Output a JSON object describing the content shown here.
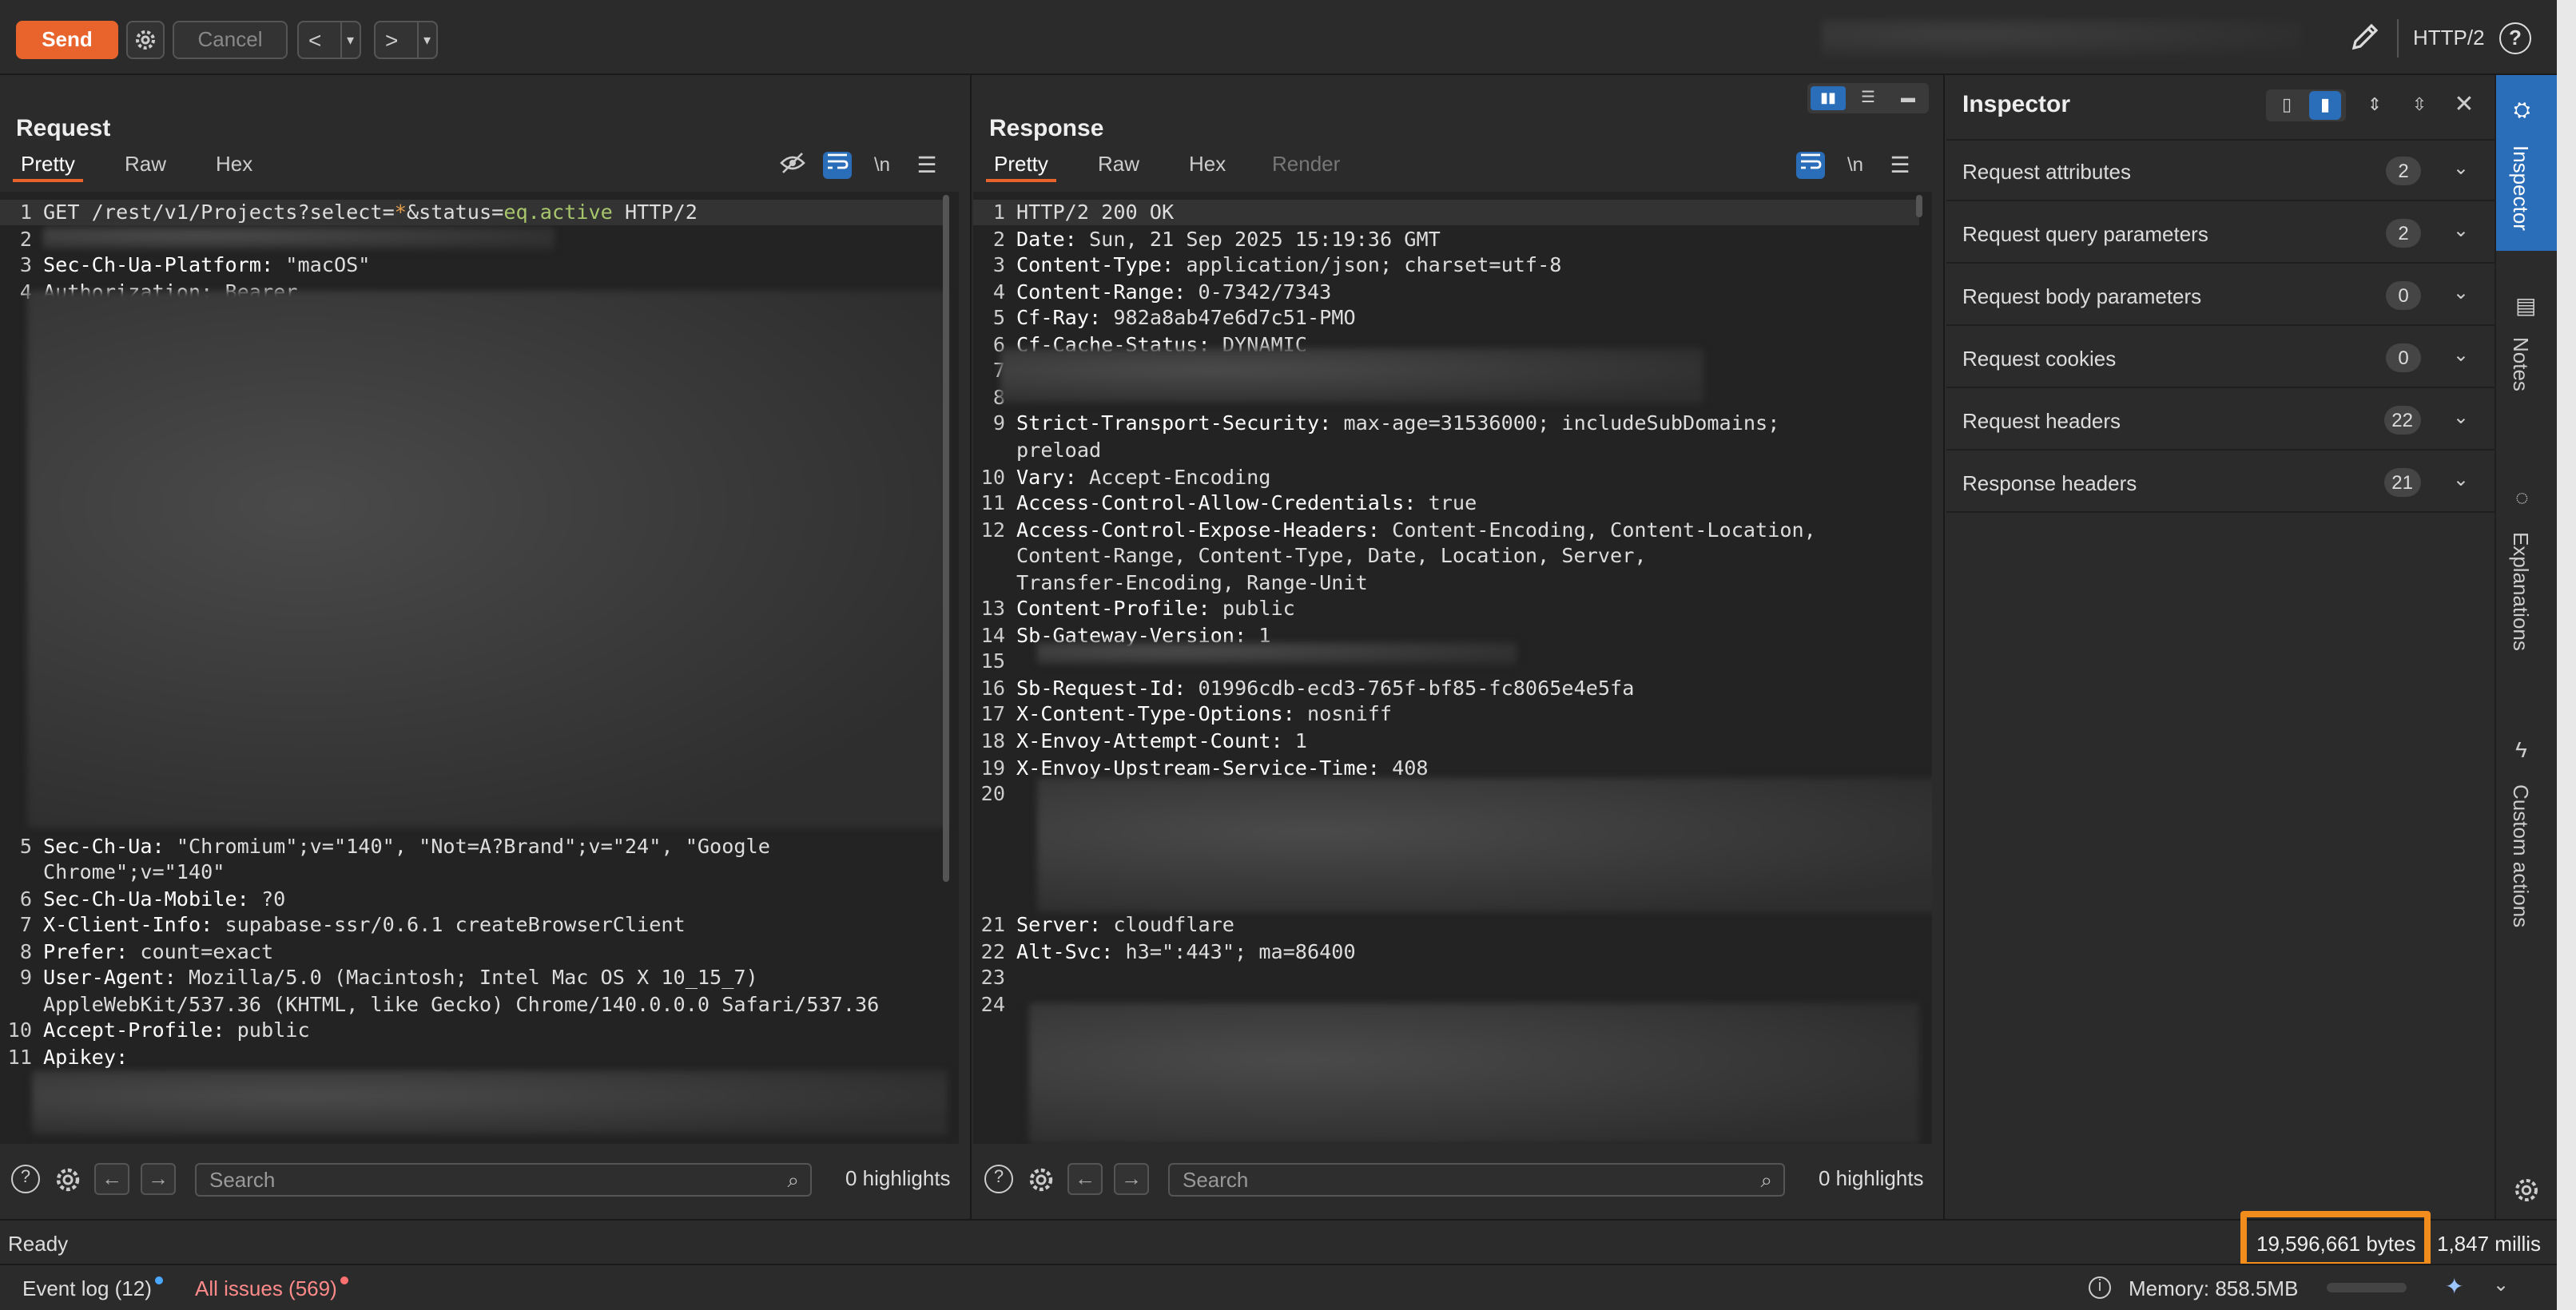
{
  "toolbar": {
    "send": "Send",
    "cancel": "Cancel",
    "back": "<",
    "forward": ">",
    "dropdown": "▾",
    "protocol": "HTTP/2"
  },
  "request": {
    "title": "Request",
    "tabs": [
      "Pretty",
      "Raw",
      "Hex"
    ],
    "active_tab": "Pretty",
    "lines": [
      {
        "n": "1",
        "parts": [
          {
            "t": "GET /rest/v1/Projects?select="
          },
          {
            "t": "*",
            "c": "orange"
          },
          {
            "t": "&status="
          },
          {
            "t": "eq.active",
            "c": "green"
          },
          {
            "t": " HTTP/2"
          }
        ]
      },
      {
        "n": "2",
        "parts": [
          {
            "t": ""
          }
        ]
      },
      {
        "n": "3",
        "parts": [
          {
            "t": "Sec-Ch-Ua-Platform:",
            "c": "k"
          },
          {
            "t": " \"macOS\""
          }
        ]
      },
      {
        "n": "4",
        "parts": [
          {
            "t": "Authorization:",
            "c": "k"
          },
          {
            "t": " Bearer"
          }
        ]
      },
      {
        "n": "5",
        "parts": [
          {
            "t": "Sec-Ch-Ua:",
            "c": "k"
          },
          {
            "t": " \"Chromium\";v=\"140\", \"Not=A?Brand\";v=\"24\", \"Google"
          }
        ]
      },
      {
        "n": "",
        "parts": [
          {
            "t": "Chrome\";v=\"140\""
          }
        ]
      },
      {
        "n": "6",
        "parts": [
          {
            "t": "Sec-Ch-Ua-Mobile:",
            "c": "k"
          },
          {
            "t": " ?0"
          }
        ]
      },
      {
        "n": "7",
        "parts": [
          {
            "t": "X-Client-Info:",
            "c": "k"
          },
          {
            "t": " supabase-ssr/0.6.1 createBrowserClient"
          }
        ]
      },
      {
        "n": "8",
        "parts": [
          {
            "t": "Prefer:",
            "c": "k"
          },
          {
            "t": " count=exact"
          }
        ]
      },
      {
        "n": "9",
        "parts": [
          {
            "t": "User-Agent:",
            "c": "k"
          },
          {
            "t": " Mozilla/5.0 (Macintosh; Intel Mac OS X 10_15_7)"
          }
        ]
      },
      {
        "n": "",
        "parts": [
          {
            "t": "AppleWebKit/537.36 (KHTML, like Gecko) Chrome/140.0.0.0 Safari/537.36"
          }
        ]
      },
      {
        "n": "10",
        "parts": [
          {
            "t": "Accept-Profile:",
            "c": "k"
          },
          {
            "t": " public"
          }
        ]
      },
      {
        "n": "11",
        "parts": [
          {
            "t": "Apikey:",
            "c": "k"
          }
        ]
      }
    ],
    "search_placeholder": "Search",
    "highlights": "0 highlights"
  },
  "response": {
    "title": "Response",
    "tabs": [
      "Pretty",
      "Raw",
      "Hex",
      "Render"
    ],
    "active_tab": "Pretty",
    "lines": [
      {
        "n": "1",
        "parts": [
          {
            "t": "HTTP/2 200 OK"
          }
        ]
      },
      {
        "n": "2",
        "parts": [
          {
            "t": "Date:",
            "c": "k"
          },
          {
            "t": " Sun, 21 Sep 2025 15:19:36 GMT"
          }
        ]
      },
      {
        "n": "3",
        "parts": [
          {
            "t": "Content-Type:",
            "c": "k"
          },
          {
            "t": " application/json; charset=utf-8"
          }
        ]
      },
      {
        "n": "4",
        "parts": [
          {
            "t": "Content-Range:",
            "c": "k"
          },
          {
            "t": " 0-7342/7343"
          }
        ]
      },
      {
        "n": "5",
        "parts": [
          {
            "t": "Cf-Ray:",
            "c": "k"
          },
          {
            "t": " 982a8ab47e6d7c51-PMO"
          }
        ]
      },
      {
        "n": "6",
        "parts": [
          {
            "t": "Cf-Cache-Status:",
            "c": "k"
          },
          {
            "t": " DYNAMIC"
          }
        ]
      },
      {
        "n": "7",
        "parts": [
          {
            "t": ""
          }
        ]
      },
      {
        "n": "8",
        "parts": [
          {
            "t": ""
          }
        ]
      },
      {
        "n": "9",
        "parts": [
          {
            "t": "Strict-Transport-Security:",
            "c": "k"
          },
          {
            "t": " max-age=31536000; includeSubDomains;"
          }
        ]
      },
      {
        "n": "",
        "parts": [
          {
            "t": "preload"
          }
        ]
      },
      {
        "n": "10",
        "parts": [
          {
            "t": "Vary:",
            "c": "k"
          },
          {
            "t": " Accept-Encoding"
          }
        ]
      },
      {
        "n": "11",
        "parts": [
          {
            "t": "Access-Control-Allow-Credentials:",
            "c": "k"
          },
          {
            "t": " true"
          }
        ]
      },
      {
        "n": "12",
        "parts": [
          {
            "t": "Access-Control-Expose-Headers:",
            "c": "k"
          },
          {
            "t": " Content-Encoding, Content-Location,"
          }
        ]
      },
      {
        "n": "",
        "parts": [
          {
            "t": "Content-Range, Content-Type, Date, Location, Server,"
          }
        ]
      },
      {
        "n": "",
        "parts": [
          {
            "t": "Transfer-Encoding, Range-Unit"
          }
        ]
      },
      {
        "n": "13",
        "parts": [
          {
            "t": "Content-Profile:",
            "c": "k"
          },
          {
            "t": " public"
          }
        ]
      },
      {
        "n": "14",
        "parts": [
          {
            "t": "Sb-Gateway-Version:",
            "c": "k"
          },
          {
            "t": " 1"
          }
        ]
      },
      {
        "n": "15",
        "parts": [
          {
            "t": ""
          }
        ]
      },
      {
        "n": "16",
        "parts": [
          {
            "t": "Sb-Request-Id:",
            "c": "k"
          },
          {
            "t": " 01996cdb-ecd3-765f-bf85-fc8065e4e5fa"
          }
        ]
      },
      {
        "n": "17",
        "parts": [
          {
            "t": "X-Content-Type-Options:",
            "c": "k"
          },
          {
            "t": " nosniff"
          }
        ]
      },
      {
        "n": "18",
        "parts": [
          {
            "t": "X-Envoy-Attempt-Count:",
            "c": "k"
          },
          {
            "t": " 1"
          }
        ]
      },
      {
        "n": "19",
        "parts": [
          {
            "t": "X-Envoy-Upstream-Service-Time:",
            "c": "k"
          },
          {
            "t": " 408"
          }
        ]
      },
      {
        "n": "20",
        "parts": [
          {
            "t": ""
          }
        ]
      },
      {
        "n": "21",
        "parts": [
          {
            "t": "Server:",
            "c": "k"
          },
          {
            "t": " cloudflare"
          }
        ]
      },
      {
        "n": "22",
        "parts": [
          {
            "t": "Alt-Svc:",
            "c": "k"
          },
          {
            "t": " h3=\":443\"; ma=86400"
          }
        ]
      },
      {
        "n": "23",
        "parts": [
          {
            "t": ""
          }
        ]
      },
      {
        "n": "24",
        "parts": [
          {
            "t": ""
          }
        ]
      }
    ],
    "search_placeholder": "Search",
    "highlights": "0 highlights"
  },
  "inspector": {
    "title": "Inspector",
    "rows": [
      {
        "label": "Request attributes",
        "count": "2"
      },
      {
        "label": "Request query parameters",
        "count": "2"
      },
      {
        "label": "Request body parameters",
        "count": "0"
      },
      {
        "label": "Request cookies",
        "count": "0"
      },
      {
        "label": "Request headers",
        "count": "22"
      },
      {
        "label": "Response headers",
        "count": "21"
      }
    ]
  },
  "rail": {
    "inspector": "Inspector",
    "notes": "Notes",
    "explanations": "Explanations",
    "custom_actions": "Custom actions"
  },
  "status": {
    "ready": "Ready",
    "bytes": "19,596,661 bytes",
    "millis": "1,847 millis"
  },
  "footer": {
    "event_log": "Event log (12)",
    "all_issues": "All issues (569)",
    "memory": "Memory: 858.5MB"
  },
  "colors": {
    "accent": "#e8642c",
    "highlight_box": "#f28c1c",
    "toggle_blue": "#2a6db8",
    "issues_red": "#ff8a8a"
  }
}
